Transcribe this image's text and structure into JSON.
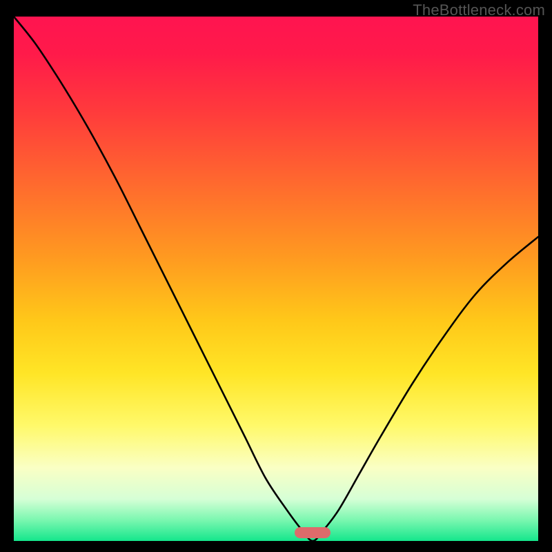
{
  "watermark": "TheBottleneck.com",
  "chart_data": {
    "type": "line",
    "title": "",
    "xlabel": "",
    "ylabel": "",
    "xlim": [
      0,
      100
    ],
    "ylim": [
      0,
      100
    ],
    "grid": false,
    "annotations": {
      "dip_marker_x": 57
    },
    "series": [
      {
        "name": "curve",
        "color": "#000000",
        "x": [
          0,
          4,
          8,
          12,
          16,
          20,
          24,
          28,
          32,
          36,
          40,
          44,
          48,
          52,
          55,
          57,
          59,
          62,
          66,
          70,
          76,
          82,
          88,
          94,
          100
        ],
        "y": [
          100,
          95,
          89,
          82.5,
          75.5,
          68,
          60,
          52,
          44,
          36,
          28,
          20,
          12,
          6,
          2,
          0,
          2,
          6,
          13,
          20,
          30,
          39,
          47,
          53,
          58
        ]
      }
    ],
    "background_gradient": {
      "direction": "vertical",
      "stops": [
        {
          "pos": 0.0,
          "color": "#ff1450"
        },
        {
          "pos": 0.32,
          "color": "#ff6a2e"
        },
        {
          "pos": 0.68,
          "color": "#ffe526"
        },
        {
          "pos": 0.92,
          "color": "#d6ffd6"
        },
        {
          "pos": 1.0,
          "color": "#14e68c"
        }
      ]
    }
  }
}
